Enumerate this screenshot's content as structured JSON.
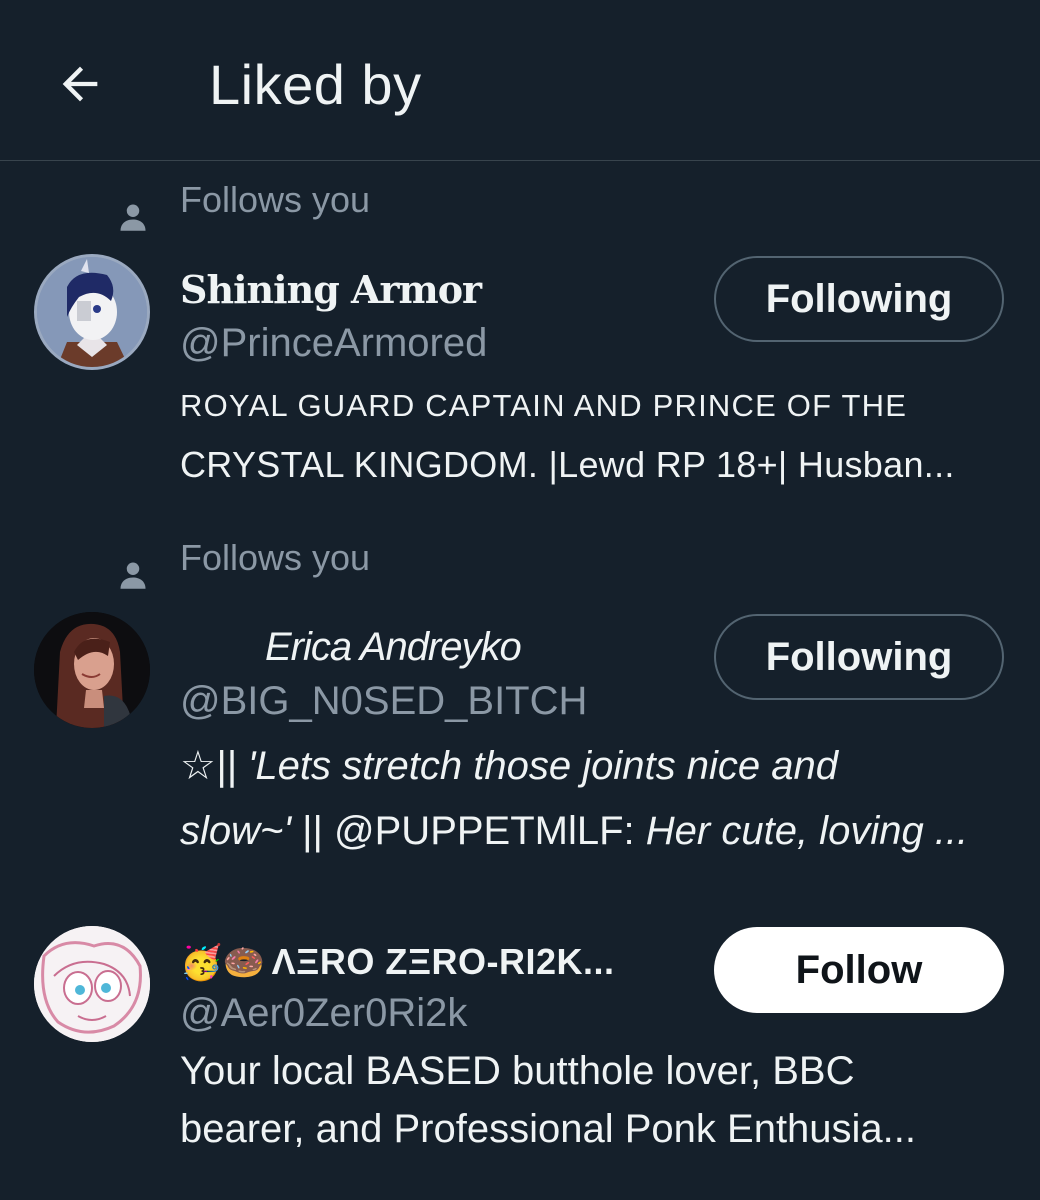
{
  "header": {
    "title": "Liked by",
    "back_icon": "arrow-left-icon"
  },
  "colors": {
    "background": "#15202b",
    "secondary_text": "#8b98a5",
    "primary_text": "#eff3f4",
    "divider": "#38444d"
  },
  "users": [
    {
      "social_context": "Follows you",
      "name": "Shining Armor",
      "handle": "@PrinceArmored",
      "bio_line1": "ROYAL GUARD CAPTAIN AND PRINCE OF THE",
      "bio_line2": "CRYSTAL KINGDOM. |Lewd RP 18+| Husban...",
      "button": "Following"
    },
    {
      "social_context": "Follows you",
      "name": "Erica Andreyko",
      "handle": "@BIG_N0SED_BITCH",
      "bio_line1": "☆|| 'Lets stretch those joints nice and",
      "bio_line2_a": "slow~'",
      "bio_line2_b": " || @PUPPETMlLF: ",
      "bio_line2_c": "Her cute, loving ...",
      "button": "Following"
    },
    {
      "name_emoji": "🥳🍩",
      "name": "ΛΞRO ZΞRO-RI2K...",
      "handle": "@Aer0Zer0Ri2k",
      "bio_line1": "Your local BASED butthole lover, BBC",
      "bio_line2": "bearer, and Professional Ponk Enthusia...",
      "button": "Follow"
    }
  ]
}
